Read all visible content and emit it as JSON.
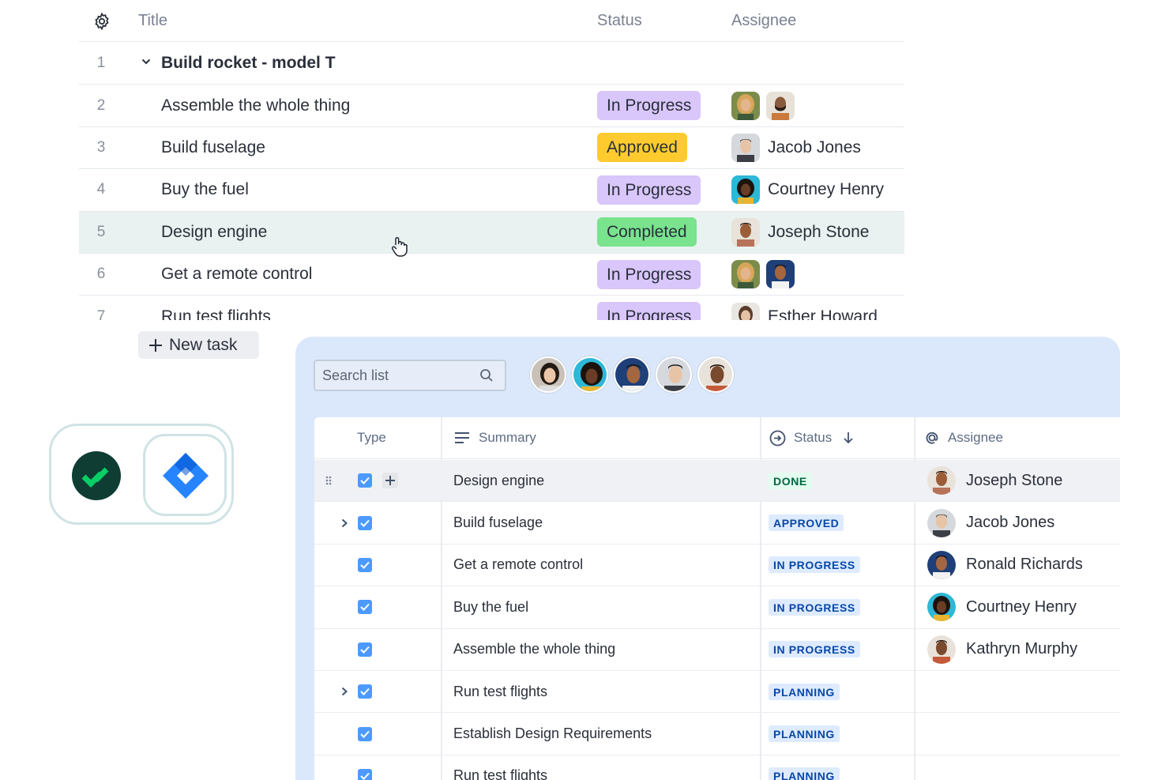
{
  "top_table": {
    "headers": {
      "title": "Title",
      "status": "Status",
      "assignee": "Assignee"
    },
    "group": {
      "num": "1",
      "title": "Build rocket - model T"
    },
    "rows": [
      {
        "num": "2",
        "title": "Assemble the whole thing",
        "status": "In Progress",
        "status_kind": "progress",
        "assignee": ""
      },
      {
        "num": "3",
        "title": "Build fuselage",
        "status": "Approved",
        "status_kind": "approved",
        "assignee": "Jacob Jones"
      },
      {
        "num": "4",
        "title": "Buy the fuel",
        "status": "In Progress",
        "status_kind": "progress",
        "assignee": "Courtney Henry"
      },
      {
        "num": "5",
        "title": "Design engine",
        "status": "Completed",
        "status_kind": "completed",
        "assignee": "Joseph Stone"
      },
      {
        "num": "6",
        "title": "Get a remote control",
        "status": "In Progress",
        "status_kind": "progress",
        "assignee": ""
      },
      {
        "num": "7",
        "title": "Run test flights",
        "status": "In Progress",
        "status_kind": "progress",
        "assignee": "Esther Howard"
      }
    ],
    "new_task": "New task"
  },
  "jira": {
    "search": {
      "placeholder": "Search list"
    },
    "headers": {
      "type": "Type",
      "summary": "Summary",
      "status": "Status",
      "assignee": "Assignee"
    },
    "rows": [
      {
        "summary": "Design engine",
        "status": "DONE",
        "assignee": "Joseph Stone"
      },
      {
        "summary": "Build fuselage",
        "status": "APPROVED",
        "assignee": "Jacob Jones"
      },
      {
        "summary": "Get a remote control",
        "status": "IN PROGRESS",
        "assignee": "Ronald Richards"
      },
      {
        "summary": "Buy the fuel",
        "status": "IN PROGRESS",
        "assignee": "Courtney Henry"
      },
      {
        "summary": "Assemble the whole thing",
        "status": "IN PROGRESS",
        "assignee": "Kathryn Murphy"
      },
      {
        "summary": "Run test flights",
        "status": "PLANNING",
        "assignee": ""
      },
      {
        "summary": "Establish Design Requirements",
        "status": "PLANNING",
        "assignee": ""
      },
      {
        "summary": "Run test flights",
        "status": "PLANNING",
        "assignee": ""
      }
    ]
  },
  "colors": {
    "pill_progress": "#d9c6fb",
    "pill_approved": "#fdcb2e",
    "pill_completed": "#79e38e",
    "jira_blue": "#2684ff",
    "wrike_green": "#0f3d34",
    "panel_bg": "#dbe8fb"
  },
  "icons": [
    "gear-icon",
    "chevron-down-icon",
    "plus-icon",
    "search-icon",
    "drag-handle-icon",
    "checkbox-icon",
    "chevron-right-icon",
    "summary-lines-icon",
    "status-arrow-icon",
    "sort-down-icon",
    "at-sign-icon",
    "wrike-logo",
    "jira-logo",
    "hand-cursor-icon"
  ]
}
